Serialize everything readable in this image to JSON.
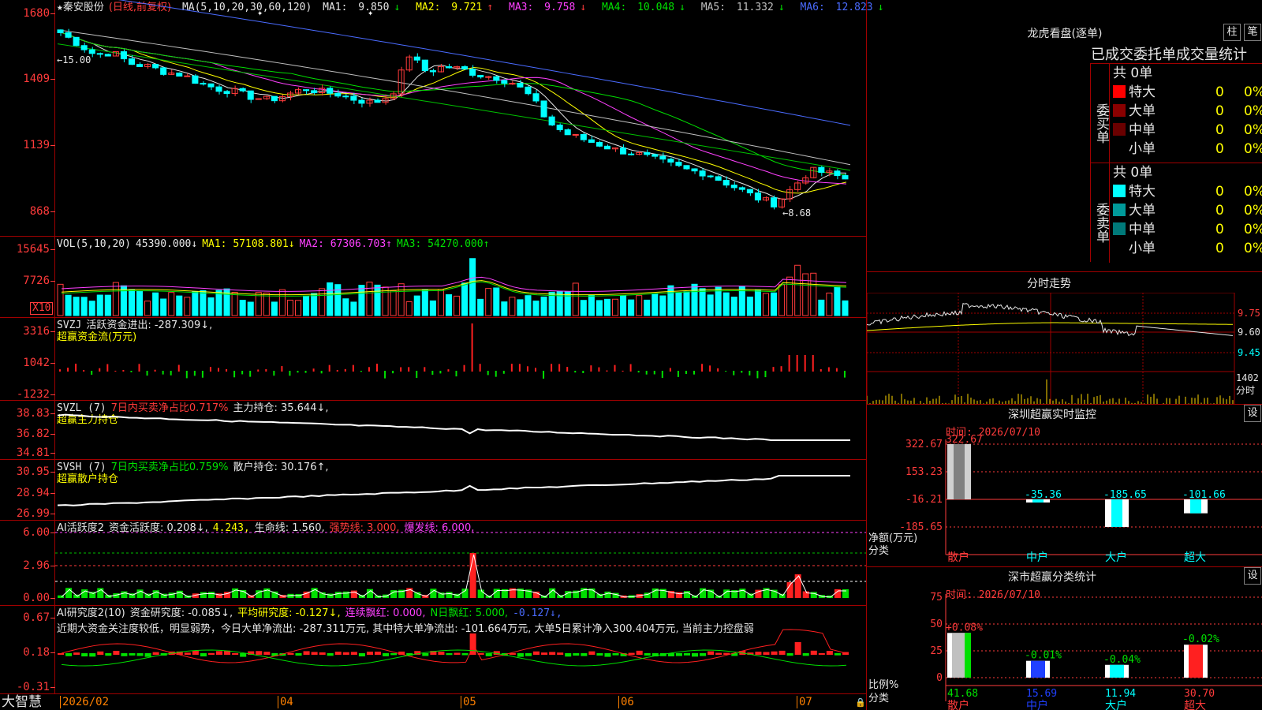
{
  "stock": {
    "star": "★",
    "name": "秦安股份",
    "period": "(日线,前复权)"
  },
  "price_pane": {
    "ma_params": "MA(5,10,20,30,60,120)",
    "ma": [
      {
        "label": "MA1:",
        "value": "9.850",
        "dir": "↓",
        "color": "#e6e6e6"
      },
      {
        "label": "MA2:",
        "value": "9.721",
        "dir": "↑",
        "color": "#ffff00"
      },
      {
        "label": "MA3:",
        "value": "9.758",
        "dir": "↓",
        "color": "#ff40ff"
      },
      {
        "label": "MA4:",
        "value": "10.048",
        "dir": "↓",
        "color": "#00e000"
      },
      {
        "label": "MA5:",
        "value": "11.332",
        "dir": "↓",
        "color": "#c0c0c0"
      },
      {
        "label": "MA6:",
        "value": "12.823",
        "dir": "↓",
        "color": "#4a6bff"
      }
    ],
    "yticks": [
      "1680",
      "1409",
      "1139",
      "868"
    ],
    "high_mark": "←15.00",
    "low_mark": "←8.68"
  },
  "vol_pane": {
    "params": "VOL(5,10,20)",
    "value": "45390.000↓",
    "ma1": "MA1: 57108.801↓",
    "ma2": "MA2: 67306.703↑",
    "ma3": "MA3: 54270.000↑",
    "yticks": [
      "15645",
      "7726"
    ],
    "unit": "X10"
  },
  "svzj_pane": {
    "title": "SVZJ",
    "label": "活跃资金进出: -287.309↓,",
    "sub": "超赢资金流(万元)",
    "yticks": [
      "3316",
      "1042",
      "-1232"
    ]
  },
  "svzl_pane": {
    "title": "SVZL (7)",
    "label1": "7日内买卖净占比0.717%",
    "label2": "主力持仓: 35.644↓,",
    "sub": "超赢主力持仓",
    "yticks": [
      "38.83",
      "36.82",
      "34.81"
    ]
  },
  "svsh_pane": {
    "title": "SVSH (7)",
    "label1": "7日内买卖净占比0.759%",
    "label2": "散户持仓: 30.176↑,",
    "sub": "超赢散户持仓",
    "yticks": [
      "30.95",
      "28.94",
      "26.99"
    ]
  },
  "ai_active": {
    "title": "AI活跃度2",
    "l1": "资金活跃度: 0.208↓,",
    "l2": "4.243,",
    "l3": "生命线: 1.560,",
    "l4": "强势线: 3.000,",
    "l5": "爆发线: 6.000,",
    "yticks": [
      "6.00",
      "2.96",
      "0.00"
    ]
  },
  "ai_research": {
    "title": "AI研究度2(10)",
    "l1": "资金研究度: -0.085↓,",
    "l2": "平均研究度: -0.127↓,",
    "l3": "连续飘红: 0.000,",
    "l4": "N日飘红: 5.000,",
    "l5": "-0.127↓,",
    "text": "近期大资金关注度较低，明显弱势，今日大单净流出: -287.311万元, 其中特大单净流出: -101.664万元, 大单5日累计净入300.404万元, 当前主力控盘弱",
    "yticks": [
      "0.67",
      "0.18",
      "-0.31"
    ]
  },
  "xaxis": {
    "brand": "大智慧",
    "labels": [
      "2026/02",
      "04",
      "05",
      "06",
      "07"
    ]
  },
  "dragon": {
    "title": "龙虎看盘(逐单)",
    "btn1": "柱",
    "btn2": "笔",
    "tabs": "已成交委托单成交量统计",
    "buy": {
      "side": "委买单",
      "total": "共 0单",
      "rows": [
        {
          "name": "特大",
          "v": "0",
          "p": "0%",
          "color": "#ff0000"
        },
        {
          "name": "大单",
          "v": "0",
          "p": "0%",
          "color": "#8a0000"
        },
        {
          "name": "中单",
          "v": "0",
          "p": "0%",
          "color": "#6a0000"
        },
        {
          "name": "小单",
          "v": "0",
          "p": "0%",
          "color": "#000000"
        }
      ]
    },
    "sell": {
      "side": "委卖单",
      "total": "共 0单",
      "rows": [
        {
          "name": "特大",
          "v": "0",
          "p": "0%",
          "color": "#00ffff"
        },
        {
          "name": "大单",
          "v": "0",
          "p": "0%",
          "color": "#009a9a"
        },
        {
          "name": "中单",
          "v": "0",
          "p": "0%",
          "color": "#007a7a"
        },
        {
          "name": "小单",
          "v": "0",
          "p": "0%",
          "color": "#000000"
        }
      ]
    }
  },
  "intraday": {
    "title": "分时走势",
    "yticks": [
      "9.75",
      "9.60",
      "9.45"
    ],
    "vol_tick": "1402",
    "unit": "分时"
  },
  "sz_monitor": {
    "title": "深圳超赢实时监控",
    "btn": "设",
    "time": "时间: 2026/07/10",
    "yticks": [
      "322.67",
      "153.23",
      "-16.21",
      "-185.65"
    ],
    "ylabel": "净额(万元)",
    "xlabel": "分类"
  },
  "sz_stats": {
    "title": "深市超赢分类统计",
    "btn": "设",
    "time": "时间: 2026/07/10",
    "yticks": [
      "75",
      "50",
      "25",
      "0"
    ],
    "ylabel": "比例%",
    "xlabel": "分类"
  },
  "chart_data": [
    {
      "type": "bar",
      "title": "深圳超赢实时监控",
      "categories": [
        "散户",
        "中户",
        "大户",
        "超大"
      ],
      "values": [
        322.67,
        -35.36,
        -185.65,
        -101.66
      ],
      "ylabel": "净额(万元)",
      "xlabel": "分类",
      "ylim": [
        -185.65,
        322.67
      ]
    },
    {
      "type": "bar",
      "title": "深市超赢分类统计",
      "categories": [
        "散户",
        "中户",
        "大户",
        "超大"
      ],
      "series": [
        {
          "values": [
            41.68,
            15.69,
            11.94,
            30.7
          ]
        },
        {
          "values": [
            0.08,
            -0.01,
            -0.04,
            -0.02
          ]
        }
      ],
      "ylabel": "比例%",
      "xlabel": "分类",
      "ylim": [
        0,
        75
      ]
    },
    {
      "type": "line",
      "title": "秦安股份(日线,前复权)",
      "x": [
        "2026/02",
        "04",
        "05",
        "06",
        "07"
      ],
      "series": [
        {
          "name": "MA1",
          "last": 9.85
        },
        {
          "name": "MA2",
          "last": 9.721
        },
        {
          "name": "MA3",
          "last": 9.758
        },
        {
          "name": "MA4",
          "last": 10.048
        },
        {
          "name": "MA5",
          "last": 11.332
        },
        {
          "name": "MA6",
          "last": 12.823
        }
      ],
      "ylim": [
        8.68,
        15.0
      ]
    }
  ]
}
